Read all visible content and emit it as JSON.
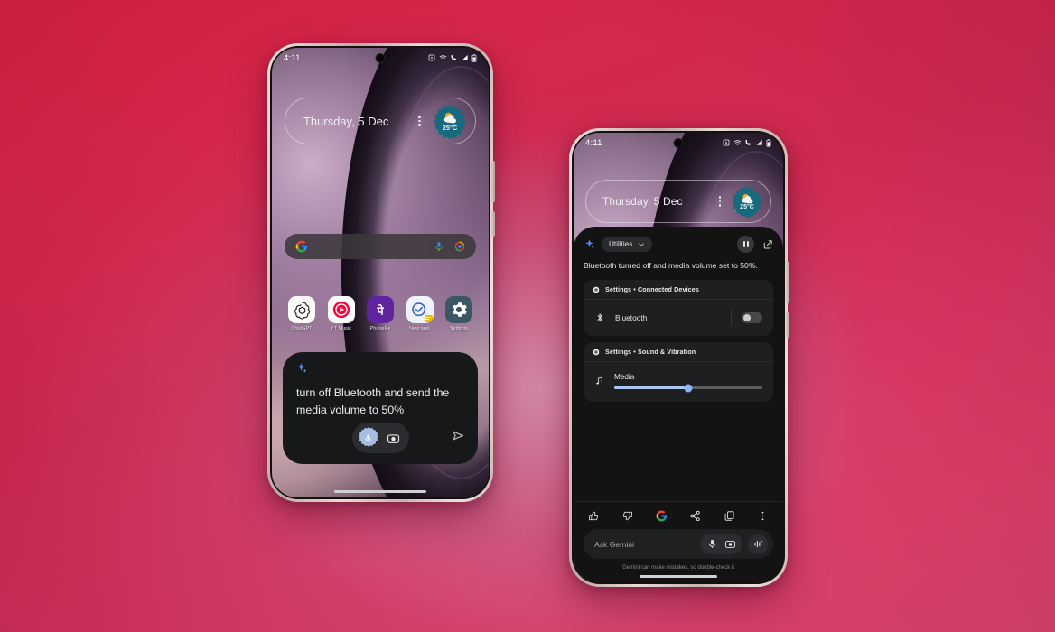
{
  "background": {
    "accent_start": "#dc2444",
    "accent_end": "#e04a72",
    "glow": "#c4567f"
  },
  "phone_left": {
    "status": {
      "time": "4:11",
      "icons": [
        "alarm-icon",
        "wifi-icon",
        "call-icon",
        "signal-icon",
        "battery-icon"
      ]
    },
    "widget": {
      "date": "Thursday, 5 Dec",
      "temperature": "25°C",
      "weather_icon": "sun-cloud-icon",
      "overflow_icon": "more-vert-icon"
    },
    "search": {
      "placeholder": "",
      "leading_icon": "google-g-icon",
      "mic_icon": "mic-icon",
      "lens_icon": "lens-icon"
    },
    "apps": [
      {
        "label": "ChatGPT",
        "icon": "chatgpt-icon"
      },
      {
        "label": "YT Music",
        "icon": "yt-music-icon"
      },
      {
        "label": "PhonePe",
        "icon": "phonepe-icon"
      },
      {
        "label": "New task",
        "icon": "new-task-icon"
      },
      {
        "label": "Settings",
        "icon": "settings-gear-icon"
      }
    ],
    "prompt_card": {
      "spark_icon": "gemini-spark-icon",
      "text": "turn off Bluetooth and send the media volume to 50%",
      "mic_icon": "mic-icon",
      "camera_icon": "camera-icon",
      "send_icon": "send-icon"
    }
  },
  "phone_right": {
    "status": {
      "time": "4:11",
      "icons": [
        "alarm-icon",
        "wifi-icon",
        "call-icon",
        "signal-icon",
        "battery-icon"
      ]
    },
    "widget": {
      "date": "Thursday, 5 Dec",
      "temperature": "25°C",
      "weather_icon": "sun-cloud-icon",
      "overflow_icon": "more-vert-icon"
    },
    "gemini": {
      "spark_icon": "gemini-spark-icon",
      "chip_label": "Utilities",
      "chip_caret_icon": "chevron-down-icon",
      "pause_icon": "pause-icon",
      "expand_icon": "open-in-new-icon",
      "answer": "Bluetooth turned off and media volume set to 50%.",
      "cards": [
        {
          "header": "Settings • Connected Devices",
          "header_icon": "settings-dot-icon",
          "row_icon": "bluetooth-icon",
          "row_label": "Bluetooth",
          "control": "toggle",
          "toggle_on": false
        },
        {
          "header": "Settings • Sound & Vibration",
          "header_icon": "settings-dot-icon",
          "row_icon": "music-note-icon",
          "row_label": "Media",
          "control": "slider",
          "slider_value": 50
        }
      ],
      "toolbar": [
        {
          "name": "thumb-up-icon"
        },
        {
          "name": "thumb-down-icon"
        },
        {
          "name": "google-g-icon"
        },
        {
          "name": "share-icon"
        },
        {
          "name": "copy-icon"
        },
        {
          "name": "more-vert-icon"
        }
      ],
      "input": {
        "placeholder": "Ask Gemini",
        "mic_icon": "mic-icon",
        "camera_icon": "camera-icon",
        "waveform_icon": "waveform-icon"
      },
      "disclaimer": "Gemini can make mistakes, so double-check it"
    }
  }
}
